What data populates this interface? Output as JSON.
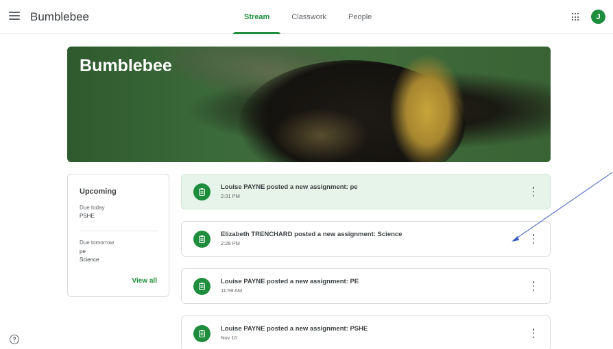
{
  "header": {
    "app_title": "Bumblebee",
    "tabs": [
      {
        "label": "Stream",
        "active": true
      },
      {
        "label": "Classwork",
        "active": false
      },
      {
        "label": "People",
        "active": false
      }
    ],
    "avatar_letter": "J",
    "accent_color": "#1e8e3e"
  },
  "banner": {
    "title": "Bumblebee"
  },
  "upcoming": {
    "title": "Upcoming",
    "due_today_label": "Due today",
    "due_today_items": [
      "PSHE"
    ],
    "due_tomorrow_label": "Due tomorrow",
    "due_tomorrow_items": [
      "pe",
      "Science"
    ],
    "view_all_label": "View all"
  },
  "stream": {
    "posts": [
      {
        "text": "Louise PAYNE posted a new assignment: pe",
        "time": "2:31 PM",
        "highlighted": true,
        "icon": "assignment-icon"
      },
      {
        "text": "Elizabeth TRENCHARD posted a new assignment: Science",
        "time": "2:28 PM",
        "highlighted": false,
        "icon": "assignment-icon"
      },
      {
        "text": "Louise PAYNE posted a new assignment: PE",
        "time": "11:59 AM",
        "highlighted": false,
        "icon": "assignment-icon"
      },
      {
        "text": "Louise PAYNE posted a new assignment: PSHE",
        "time": "Nov 10",
        "highlighted": false,
        "icon": "assignment-icon"
      }
    ]
  },
  "help": {
    "glyph": "?"
  }
}
